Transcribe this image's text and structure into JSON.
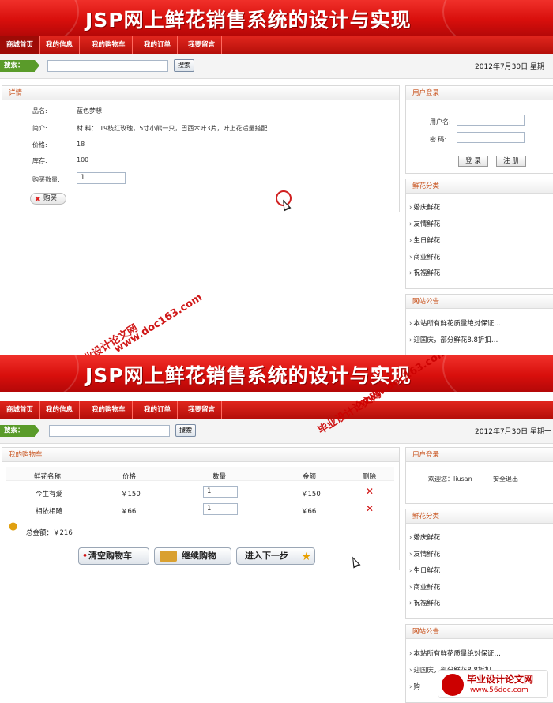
{
  "site": {
    "title": "JSP网上鲜花销售系统的设计与实现",
    "nav": [
      "商城首页",
      "我的信息",
      "我的购物车",
      "我的订单",
      "我要留言"
    ],
    "search_label": "搜索：",
    "search_button": "搜索",
    "date": "2012年7月30日 星期一"
  },
  "screen1": {
    "detail": {
      "heading": "详情",
      "name_label": "品名:",
      "name_value": "蓝色梦想",
      "desc_label": "简介:",
      "desc_value": "材 料： 19枝红玫瑰，5寸小熊一只，巴西木叶3片，叶上花适量搭配",
      "price_label": "价格:",
      "price_value": "18",
      "stock_label": "库存:",
      "stock_value": "100",
      "qty_label": "购买数量:",
      "qty_value": "1",
      "buy_button": "购买"
    },
    "login": {
      "heading": "用户登录",
      "username_label": "用户名:",
      "password_label": "密  码:",
      "login_button": "登 录",
      "register_button": "注 册"
    }
  },
  "screen2": {
    "cart": {
      "heading": "我的购物车",
      "columns": [
        "鲜花名称",
        "价格",
        "数量",
        "金额",
        "删除"
      ],
      "rows": [
        {
          "name": "今生有爱",
          "price": "￥150",
          "qty": "1",
          "amount": "￥150"
        },
        {
          "name": "相依相随",
          "price": "￥66",
          "qty": "1",
          "amount": "￥66"
        }
      ],
      "total": "总金额：￥216",
      "clear_button": "清空购物车",
      "continue_button": "继续购物",
      "next_button": "进入下一步"
    },
    "login": {
      "heading": "用户登录",
      "welcome": "欢迎您：liusan",
      "logout": "安全退出"
    }
  },
  "sidebar": {
    "category_heading": "鲜花分类",
    "categories": [
      "婚庆鲜花",
      "友情鲜花",
      "生日鲜花",
      "商业鲜花",
      "祝福鲜花"
    ],
    "notice_heading": "网站公告",
    "notices_1": [
      "本站所有鲜花质量绝对保证…",
      "迎国庆，部分鲜花8.8折扣…"
    ],
    "notices_2": [
      "本站所有鲜花质量绝对保证…",
      "迎国庆，部分鲜花8.8折扣…",
      "购"
    ]
  },
  "watermark": {
    "url": "www.doc163.com",
    "text": "毕业设计论文网",
    "logo_title": "毕业设计论文网",
    "logo_url": "www.56doc.com"
  },
  "colors": {
    "brand_red": "#d80f0c",
    "search_green": "#5a9b2a",
    "panel_title": "#c8511b"
  }
}
